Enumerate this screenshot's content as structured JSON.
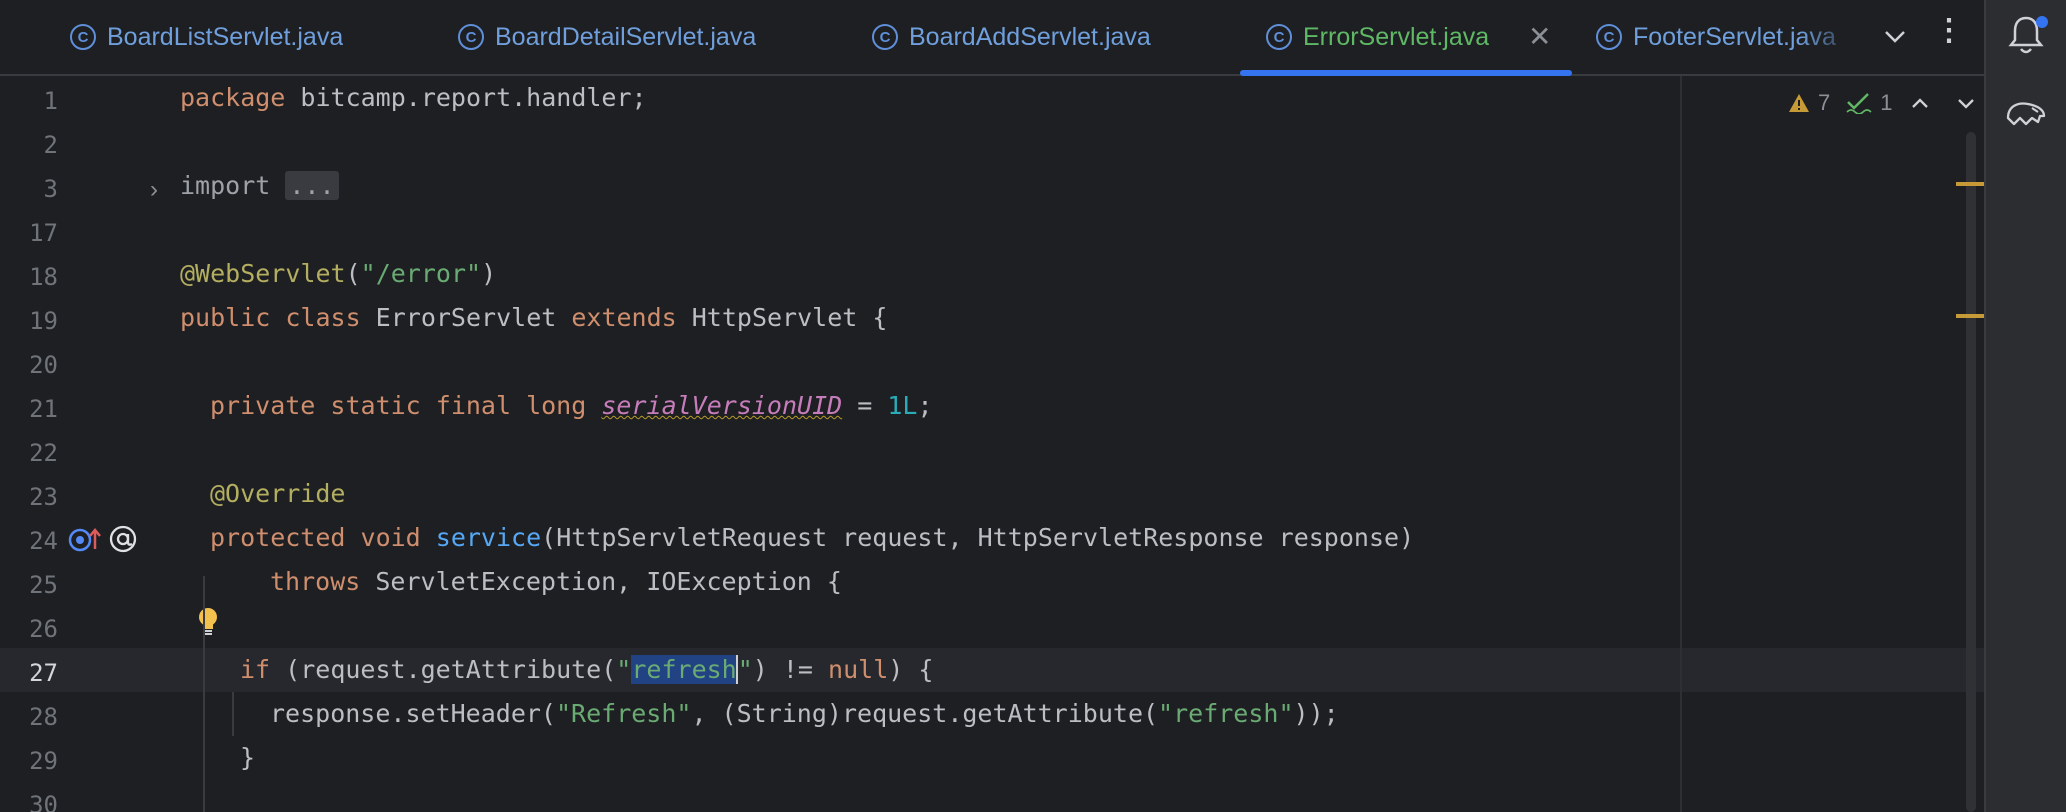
{
  "tabs": [
    {
      "label": "BoardListServlet.java",
      "icon": "class-icon",
      "active": false
    },
    {
      "label": "BoardDetailServlet.java",
      "icon": "class-icon",
      "active": false
    },
    {
      "label": "BoardAddServlet.java",
      "icon": "class-icon",
      "active": false
    },
    {
      "label": "ErrorServlet.java",
      "icon": "class-icon",
      "active": true
    },
    {
      "label": "FooterServlet.java",
      "icon": "class-icon",
      "active": false
    }
  ],
  "inspection": {
    "warnings": "7",
    "typos": "1"
  },
  "line_numbers": [
    "1",
    "2",
    "3",
    "17",
    "18",
    "19",
    "20",
    "21",
    "22",
    "23",
    "24",
    "25",
    "26",
    "27",
    "28",
    "29",
    "30"
  ],
  "current_line": "27",
  "code": {
    "pkg_kw": "package",
    "pkg_name": " bitcamp.report.handler;",
    "import_kw": "import",
    "import_fold": "...",
    "ann_webservlet": "@WebServlet",
    "ann_args_open": "(",
    "ann_path": "\"/error\"",
    "ann_args_close": ")",
    "class_mods": "public class",
    "class_name": " ErrorServlet ",
    "extends_kw": "extends",
    "class_super": " HttpServlet {",
    "field_mods": "private static final long",
    "field_name": "serialVersionUID",
    "field_eq": " = ",
    "field_val": "1L",
    "field_semi": ";",
    "override": "@Override",
    "method_mods": "protected void",
    "method_name": "service",
    "method_params": "(HttpServletRequest request, HttpServletResponse response)",
    "throws_kw": "throws",
    "throws_types": " ServletException, IOException {",
    "if_kw": "if",
    "if_open": " (request.getAttribute(",
    "if_q1": "\"",
    "if_sel": "refresh",
    "if_q2": "\"",
    "if_neq": ") != ",
    "if_null": "null",
    "if_close": ") {",
    "set_call": "response.setHeader(",
    "set_str1": "\"Refresh\"",
    "set_mid": ", (String)request.getAttribute(",
    "set_str2": "\"refresh\"",
    "set_end": "));",
    "brace_close": "}"
  }
}
